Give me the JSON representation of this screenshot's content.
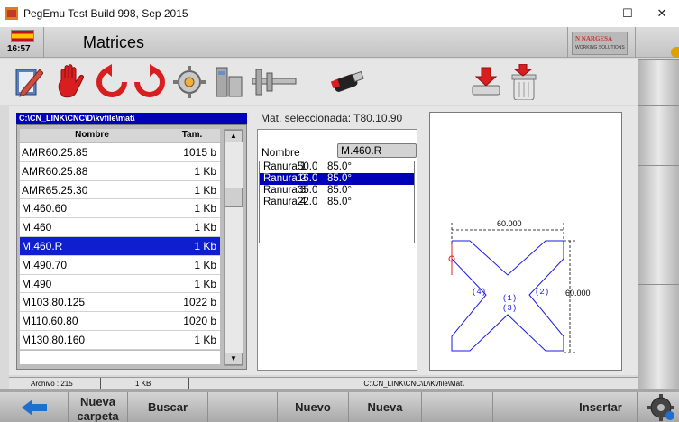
{
  "window": {
    "title": "PegEmu Test Build 998, Sep 2015",
    "minimize_glyph": "—",
    "maximize_glyph": "☐",
    "close_glyph": "✕"
  },
  "header": {
    "clock": "16:57",
    "page_title": "Matrices",
    "logo_line1": "N NARGESA",
    "logo_line2": "WORKING SOLUTIONS"
  },
  "toolbar": {
    "icons": [
      "edit-icon",
      "hand-icon",
      "rotate-left-icon",
      "rotate-right-icon",
      "settings-gear-icon",
      "clamp-icon",
      "caliper-icon",
      "usb-drive-icon",
      "import-disk-icon",
      "delete-trash-icon"
    ]
  },
  "file_list": {
    "path": "C:\\CN_LINK\\CNC\\D\\kvfile\\mat\\",
    "col_name": "Nombre",
    "col_size": "Tam.",
    "rows": [
      {
        "name": "AMR60.25.85",
        "size": "1015 b",
        "selected": false
      },
      {
        "name": "AMR60.25.88",
        "size": "1 Kb",
        "selected": false
      },
      {
        "name": "AMR65.25.30",
        "size": "1 Kb",
        "selected": false
      },
      {
        "name": "M.460.60",
        "size": "1 Kb",
        "selected": false
      },
      {
        "name": "M.460",
        "size": "1 Kb",
        "selected": false
      },
      {
        "name": "M.460.R",
        "size": "1 Kb",
        "selected": true
      },
      {
        "name": "M.490.70",
        "size": "1 Kb",
        "selected": false
      },
      {
        "name": "M.490",
        "size": "1 Kb",
        "selected": false
      },
      {
        "name": "M103.80.125",
        "size": "1022 b",
        "selected": false
      },
      {
        "name": "M110.60.80",
        "size": "1020 b",
        "selected": false
      },
      {
        "name": "M130.80.160",
        "size": "1 Kb",
        "selected": false
      }
    ],
    "scroll_up": "▲",
    "scroll_down": "▼"
  },
  "details": {
    "selected_label": "Mat. seleccionada: T80.10.90",
    "nombre_label": "Nombre",
    "nombre_value": "M.460.R",
    "ranuras": [
      {
        "name": "Ranura 1",
        "width": "50.0",
        "angle": "85.0°",
        "selected": false
      },
      {
        "name": "Ranura 2",
        "width": "16.0",
        "angle": "85.0°",
        "selected": true
      },
      {
        "name": "Ranura 3",
        "width": "35.0",
        "angle": "85.0°",
        "selected": false
      },
      {
        "name": "Ranura 4",
        "width": "22.0",
        "angle": "85.0°",
        "selected": false
      }
    ]
  },
  "drawing": {
    "dim_width": "60.000",
    "dim_height": "60.000",
    "label_1": "(1)",
    "label_2": "(2)",
    "label_3": "(3)",
    "label_4": "(4)"
  },
  "status": {
    "archivo": "Archivo : 215",
    "size": "1 KB",
    "path": "C:\\CN_LINK\\CNC\\D\\Kvfile\\Mat\\"
  },
  "bottom": {
    "back_icon": "back-arrow-icon",
    "nueva_carpeta": "Nueva carpeta",
    "buscar": "Buscar",
    "nuevo_dibujo": "Nuevo dibujo",
    "nueva_matriz": "Nueva matriz",
    "insertar": "Insertar",
    "settings_icon": "settings-gear-icon"
  },
  "colors": {
    "selection": "#0f1fd0",
    "path_bar": "#0000b8",
    "drawing_line": "#1a1ae6",
    "back_arrow": "#1f6fd1"
  }
}
